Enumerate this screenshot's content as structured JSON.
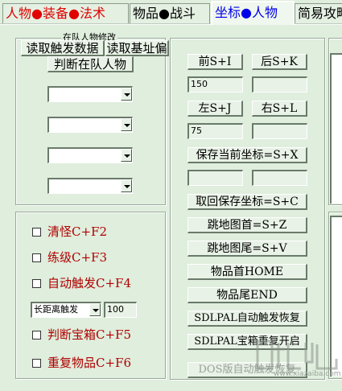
{
  "tabs": [
    {
      "parts": [
        {
          "t": "人物",
          "c": "red"
        },
        {
          "t": "●",
          "c": "red"
        },
        {
          "t": "装备",
          "c": "red"
        },
        {
          "t": "●",
          "c": "red"
        },
        {
          "t": "法术",
          "c": "red"
        }
      ]
    },
    {
      "parts": [
        {
          "t": "物品",
          "c": "blk"
        },
        {
          "t": "●",
          "c": "blk"
        },
        {
          "t": "战斗",
          "c": "blk"
        }
      ]
    },
    {
      "parts": [
        {
          "t": "坐标",
          "c": "blue"
        },
        {
          "t": "●",
          "c": "blue"
        },
        {
          "t": "人物",
          "c": "blue"
        }
      ]
    },
    {
      "parts": [
        {
          "t": "简易攻略",
          "c": "blk"
        }
      ]
    }
  ],
  "left_top": {
    "legend": "在队人物修改",
    "read_trigger_label": "读取触发数据",
    "read_base_label": "读取基址偏",
    "judge_party_label": "判断在队人物"
  },
  "left_bottom": {
    "cb_qingguai": "清怪C+F2",
    "cb_lianji": "练级C+F3",
    "cb_auto_trigger": "自动触发C+F4",
    "distance_combo_value": "长距离触发",
    "distance_value": "100",
    "cb_treasure": "判断宝箱C+F5",
    "cb_repeat_item": "重复物品C+F6"
  },
  "middle": {
    "front_label": "前S+I",
    "back_label": "后S+K",
    "front_value": "150",
    "back_value": "",
    "left_label": "左S+J",
    "right_label": "右S+L",
    "left_value": "75",
    "right_value": "",
    "save_coord_label": "保存当前坐标=S+X",
    "saved_a": "",
    "saved_b": "",
    "restore_coord_label": "取回保存坐标=S+C",
    "map_first_label": "跳地图首=S+Z",
    "map_last_label": "跳地图尾=S+V",
    "item_first_label": "物品首HOME",
    "item_last_label": "物品尾END",
    "sdlpal_auto_label": "SDLPAL自动触发恢复",
    "sdlpal_box_label": "SDLPAL宝箱重复开启",
    "dos_auto_label": "DOS版自动触发恢复"
  },
  "watermark": {
    "brand": "下载吧",
    "url": "www.xiazaiba.com"
  }
}
